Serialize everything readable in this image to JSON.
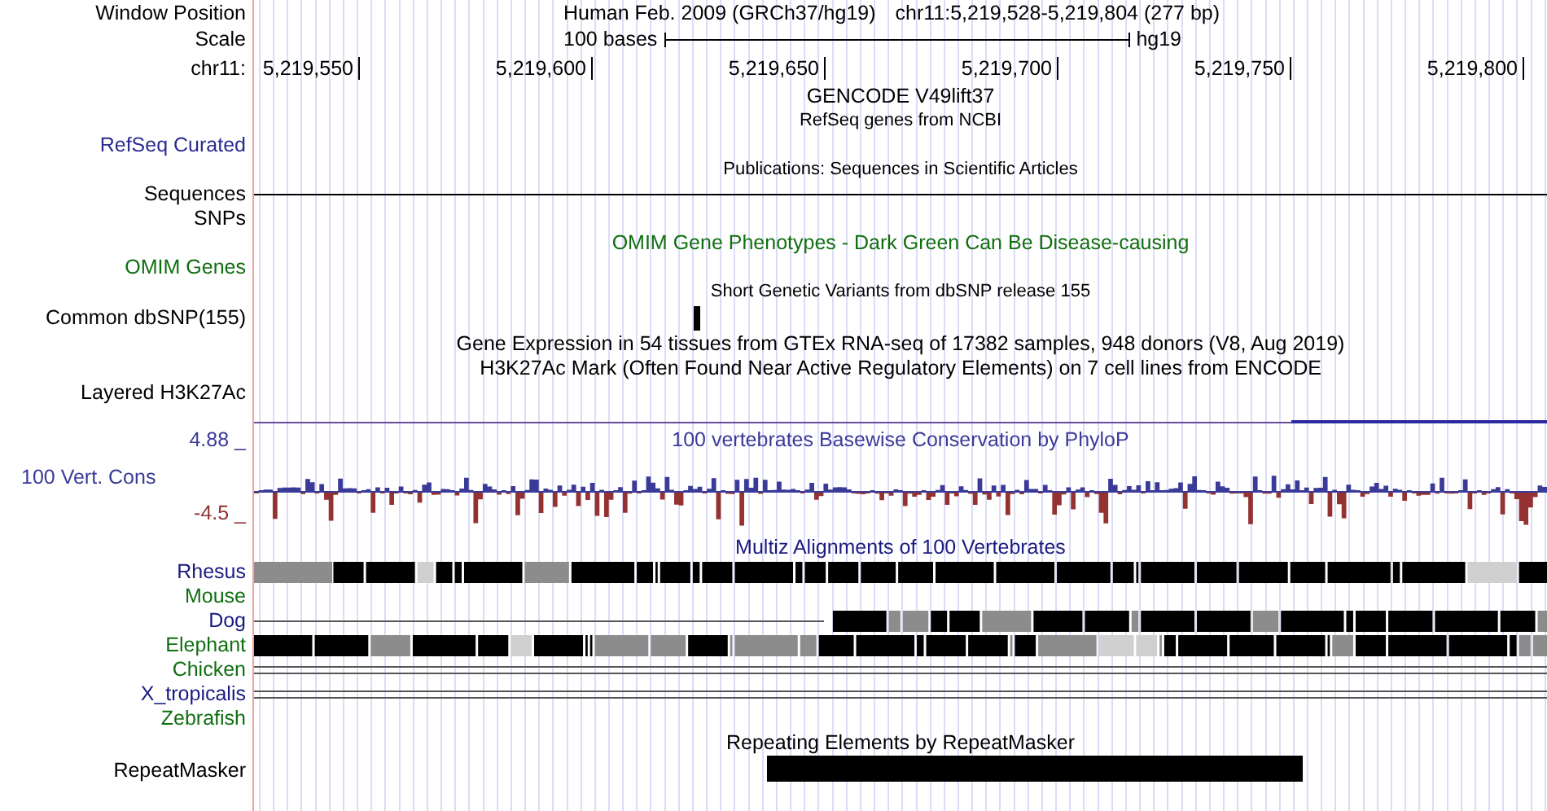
{
  "header": {
    "label": "Window Position",
    "assembly": "Human Feb. 2009 (GRCh37/hg19)",
    "position": "chr11:5,219,528-5,219,804 (277 bp)"
  },
  "scale": {
    "label": "Scale",
    "bar_label": "100 bases",
    "assembly": "hg19"
  },
  "ruler": {
    "label": "chr11:",
    "ticks": [
      "5,219,550",
      "5,219,600",
      "5,219,650",
      "5,219,700",
      "5,219,750",
      "5,219,800"
    ]
  },
  "tracks": [
    {
      "kind": "title",
      "text": "GENCODE V49lift37",
      "color": "#000000"
    },
    {
      "kind": "caption",
      "text": "RefSeq genes from NCBI",
      "color": "#000000"
    },
    {
      "kind": "label",
      "label": "RefSeq Curated",
      "color": "#2b2b8f"
    },
    {
      "kind": "caption",
      "text": "Publications: Sequences in Scientific Articles",
      "color": "#000000"
    },
    {
      "kind": "line",
      "label": "Sequences",
      "color": "#000000"
    },
    {
      "kind": "label",
      "label": "SNPs",
      "color": "#000000"
    },
    {
      "kind": "title",
      "text": "OMIM Gene Phenotypes - Dark Green Can Be Disease-causing",
      "color": "#106e10"
    },
    {
      "kind": "label",
      "label": "OMIM Genes",
      "color": "#106e10"
    },
    {
      "kind": "caption",
      "text": "Short Genetic Variants from dbSNP release 155",
      "color": "#000000"
    },
    {
      "kind": "variant",
      "label": "Common dbSNP(155)",
      "color": "#000000"
    },
    {
      "kind": "title",
      "text": "Gene Expression in 54 tissues from GTEx RNA-seq of 17382 samples, 948 donors (V8, Aug 2019)",
      "color": "#000000"
    },
    {
      "kind": "title",
      "text": "H3K27Ac Mark (Often Found Near Active Regulatory Elements) on 7 cell lines from ENCODE",
      "color": "#000000"
    },
    {
      "kind": "label",
      "label": "Layered H3K27Ac",
      "color": "#000000"
    },
    {
      "kind": "signal"
    },
    {
      "kind": "wiggle",
      "title": "100 vertebrates Basewise Conservation by PhyloP",
      "label": "100 Vert. Cons",
      "max": "4.88 _",
      "min": "-4.5 _"
    },
    {
      "kind": "title",
      "text": "Multiz Alignments of 100 Vertebrates",
      "color": "#1a1a80"
    },
    {
      "kind": "multiz",
      "species": [
        {
          "name": "Rhesus",
          "color": "#1a1a80",
          "kind": "blocks"
        },
        {
          "name": "Mouse",
          "color": "#106e10",
          "kind": "empty"
        },
        {
          "name": "Dog",
          "color": "#1a1a80",
          "kind": "partial"
        },
        {
          "name": "Elephant",
          "color": "#106e10",
          "kind": "mixed"
        },
        {
          "name": "Chicken",
          "color": "#106e10",
          "kind": "double-line"
        },
        {
          "name": "X_tropicalis",
          "color": "#1a1a80",
          "kind": "double-line"
        },
        {
          "name": "Zebrafish",
          "color": "#106e10",
          "kind": "empty"
        }
      ]
    },
    {
      "kind": "title",
      "text": "Repeating Elements by RepeatMasker",
      "color": "#000000"
    },
    {
      "kind": "repeat",
      "label": "RepeatMasker",
      "color": "#000000"
    }
  ]
}
